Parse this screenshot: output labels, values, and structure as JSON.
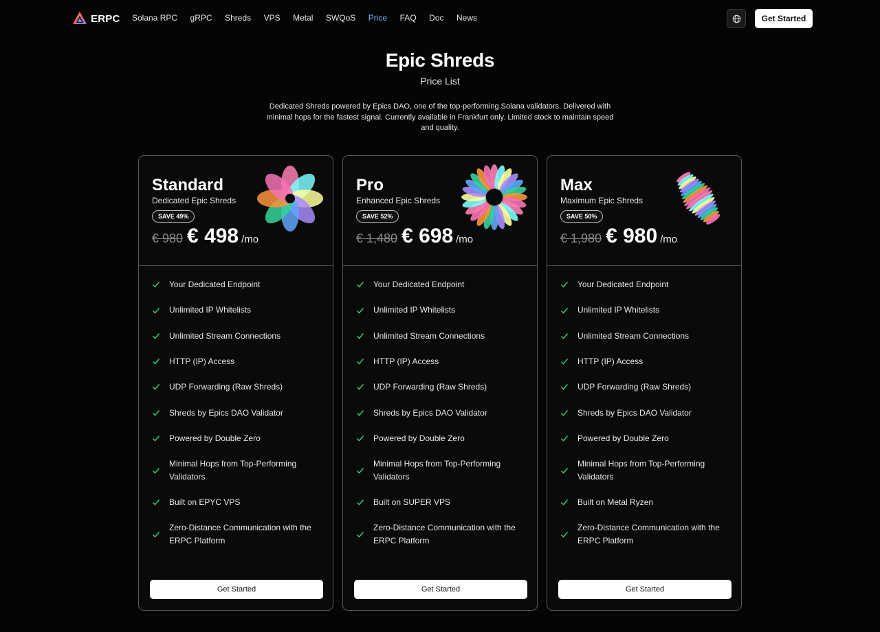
{
  "brand": {
    "name": "ERPC"
  },
  "nav": {
    "links": [
      "Solana RPC",
      "gRPC",
      "Shreds",
      "VPS",
      "Metal",
      "SWQoS",
      "Price",
      "FAQ",
      "Doc",
      "News"
    ],
    "active": "Price",
    "cta_label": "Get Started",
    "language_icon": "globe-icon"
  },
  "hero": {
    "title": "Epic Shreds",
    "subtitle": "Price List",
    "description": "Dedicated Shreds powered by Epics DAO, one of the top-performing Solana validators. Delivered with minimal hops for the fastest signal. Currently available in Frankfurt only. Limited stock to maintain speed and quality."
  },
  "colors": {
    "background": "#050505",
    "accent_active_link": "#7ab7ff",
    "check_green": "#2ecc71",
    "card_border": "#5a5a5a"
  },
  "plans": [
    {
      "name": "Standard",
      "tagline": "Dedicated Epic Shreds",
      "badge": "SAVE 49%",
      "old_price": "€ 980",
      "price": "€ 498",
      "per": "/mo",
      "features": [
        "Your Dedicated Endpoint",
        "Unlimited IP Whitelists",
        "Unlimited Stream Connections",
        "HTTP (IP) Access",
        "UDP Forwarding (Raw Shreds)",
        "Shreds by Epics DAO Validator",
        "Powered by Double Zero",
        "Minimal Hops from Top-Performing Validators",
        "Built on EPYC VPS",
        "Zero-Distance Communication with the ERPC Platform"
      ],
      "cta_label": "Get Started"
    },
    {
      "name": "Pro",
      "tagline": "Enhanced Epic Shreds",
      "badge": "SAVE 52%",
      "old_price": "€ 1,480",
      "price": "€ 698",
      "per": "/mo",
      "features": [
        "Your Dedicated Endpoint",
        "Unlimited IP Whitelists",
        "Unlimited Stream Connections",
        "HTTP (IP) Access",
        "UDP Forwarding (Raw Shreds)",
        "Shreds by Epics DAO Validator",
        "Powered by Double Zero",
        "Minimal Hops from Top-Performing Validators",
        "Built on SUPER VPS",
        "Zero-Distance Communication with the ERPC Platform"
      ],
      "cta_label": "Get Started"
    },
    {
      "name": "Max",
      "tagline": "Maximum Epic Shreds",
      "badge": "SAVE 50%",
      "old_price": "€ 1,980",
      "price": "€ 980",
      "per": "/mo",
      "features": [
        "Your Dedicated Endpoint",
        "Unlimited IP Whitelists",
        "Unlimited Stream Connections",
        "HTTP (IP) Access",
        "UDP Forwarding (Raw Shreds)",
        "Shreds by Epics DAO Validator",
        "Powered by Double Zero",
        "Minimal Hops from Top-Performing Validators",
        "Built on Metal Ryzen",
        "Zero-Distance Communication with the ERPC Platform"
      ],
      "cta_label": "Get Started"
    }
  ]
}
